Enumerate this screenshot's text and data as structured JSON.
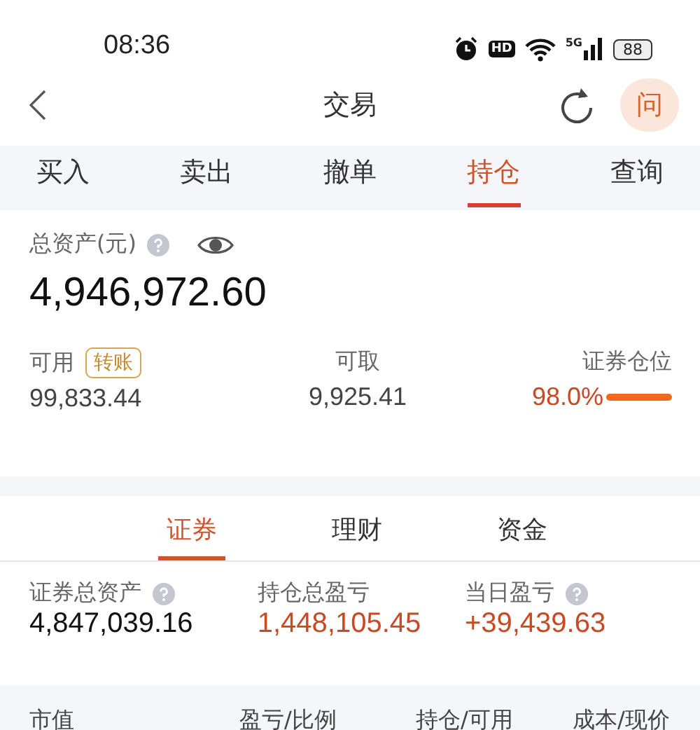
{
  "status_bar": {
    "time": "08:36",
    "hd": "HD",
    "network": "5G",
    "battery": "88"
  },
  "nav": {
    "title": "交易",
    "help": "问"
  },
  "tabs": [
    {
      "label": "买入",
      "selected": false
    },
    {
      "label": "卖出",
      "selected": false
    },
    {
      "label": "撤单",
      "selected": false
    },
    {
      "label": "持仓",
      "selected": true
    },
    {
      "label": "查询",
      "selected": false
    }
  ],
  "assets": {
    "label": "总资产(元)",
    "total": "4,946,972.60",
    "available": {
      "label": "可用",
      "transfer": "转账",
      "value": "99,833.44"
    },
    "withdrawable": {
      "label": "可取",
      "value": "9,925.41"
    },
    "position": {
      "label": "证券仓位",
      "value": "98.0%"
    }
  },
  "sub_tabs": [
    {
      "label": "证券",
      "selected": true
    },
    {
      "label": "理财",
      "selected": false
    },
    {
      "label": "资金",
      "selected": false
    }
  ],
  "summary": [
    {
      "label": "证券总资产",
      "value": "4,847,039.16",
      "help": true,
      "highlight": false
    },
    {
      "label": "持仓总盈亏",
      "value": "1,448,105.45",
      "help": false,
      "highlight": true
    },
    {
      "label": "当日盈亏",
      "value": "+39,439.63",
      "help": true,
      "highlight": true
    }
  ],
  "table": {
    "columns": [
      "市值",
      "盈亏/比例",
      "持仓/可用",
      "成本/现价"
    ]
  }
}
